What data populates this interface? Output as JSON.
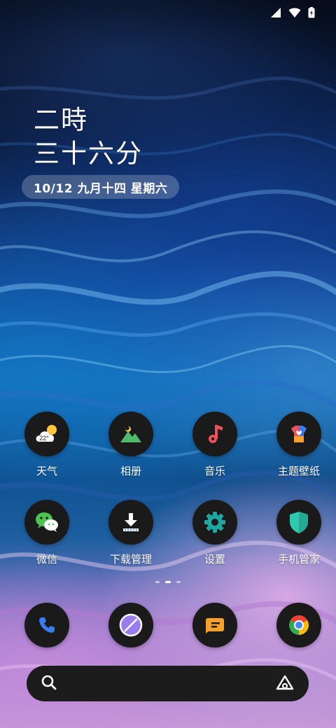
{
  "status_bar": {
    "icons": [
      "signal-icon",
      "wifi-icon",
      "battery-charging-icon"
    ]
  },
  "clock": {
    "hour_text": "二時",
    "minute_text": "三十六分"
  },
  "date": {
    "text": "10/12 九月十四 星期六"
  },
  "apps": [
    [
      {
        "label": "天气",
        "icon": "weather-icon",
        "temp": "22°"
      },
      {
        "label": "相册",
        "icon": "gallery-icon"
      },
      {
        "label": "音乐",
        "icon": "music-icon"
      },
      {
        "label": "主题壁纸",
        "icon": "themes-icon"
      }
    ],
    [
      {
        "label": "微信",
        "icon": "wechat-icon"
      },
      {
        "label": "下载管理",
        "icon": "download-icon"
      },
      {
        "label": "设置",
        "icon": "settings-gear-icon"
      },
      {
        "label": "手机管家",
        "icon": "shield-icon"
      }
    ]
  ],
  "page_indicator": {
    "pages": 3,
    "current": 2
  },
  "dock": [
    "phone-icon",
    "browser-icon",
    "messages-icon",
    "chrome-icon"
  ],
  "search_bar": {
    "left_icon": "search-icon",
    "right_icon": "assistant-icon"
  },
  "colors": {
    "icon_bg": "#1a1a1b",
    "music_red": "#f0505b",
    "gallery_green": "#4dbb6b",
    "settings_teal": "#1ea7a0",
    "shield_teal": "#30c9b0",
    "phone_blue": "#3a7bf0",
    "browser_purple": "#9b7bf0",
    "messages_orange": "#f6a12b"
  }
}
